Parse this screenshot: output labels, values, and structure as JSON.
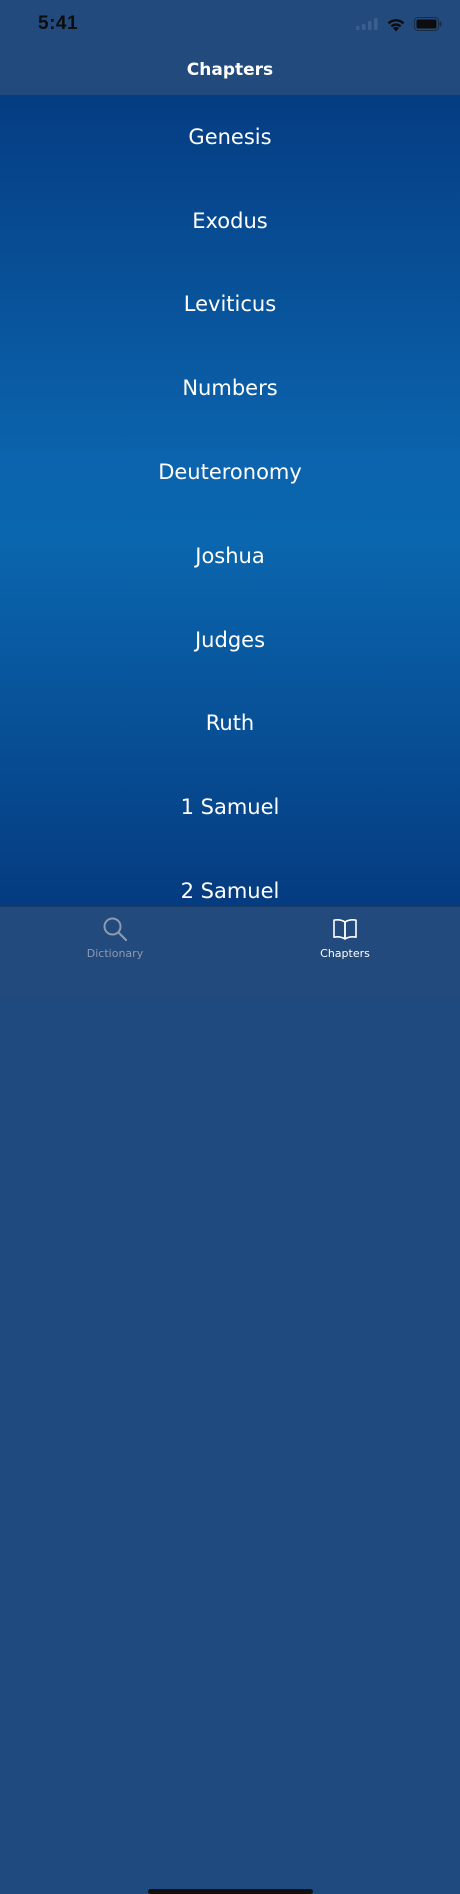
{
  "status_bar": {
    "time": "5:41",
    "icons": [
      "signal-icon",
      "wifi-icon",
      "battery-icon"
    ]
  },
  "nav": {
    "title": "Chapters"
  },
  "chapters": [
    "Genesis",
    "Exodus",
    "Leviticus",
    "Numbers",
    "Deuteronomy",
    "Joshua",
    "Judges",
    "Ruth",
    "1 Samuel",
    "2 Samuel"
  ],
  "tab_bar": {
    "tabs": [
      {
        "label": "Dictionary",
        "icon": "search-icon",
        "selected": false
      },
      {
        "label": "Chapters",
        "icon": "book-icon",
        "selected": true
      }
    ]
  },
  "colors": {
    "bar_background": "#234a7c",
    "gradient_top": "#053c82",
    "gradient_mid": "#0b64ad",
    "text": "#ffffff",
    "tab_inactive": "#8d9bb0"
  }
}
